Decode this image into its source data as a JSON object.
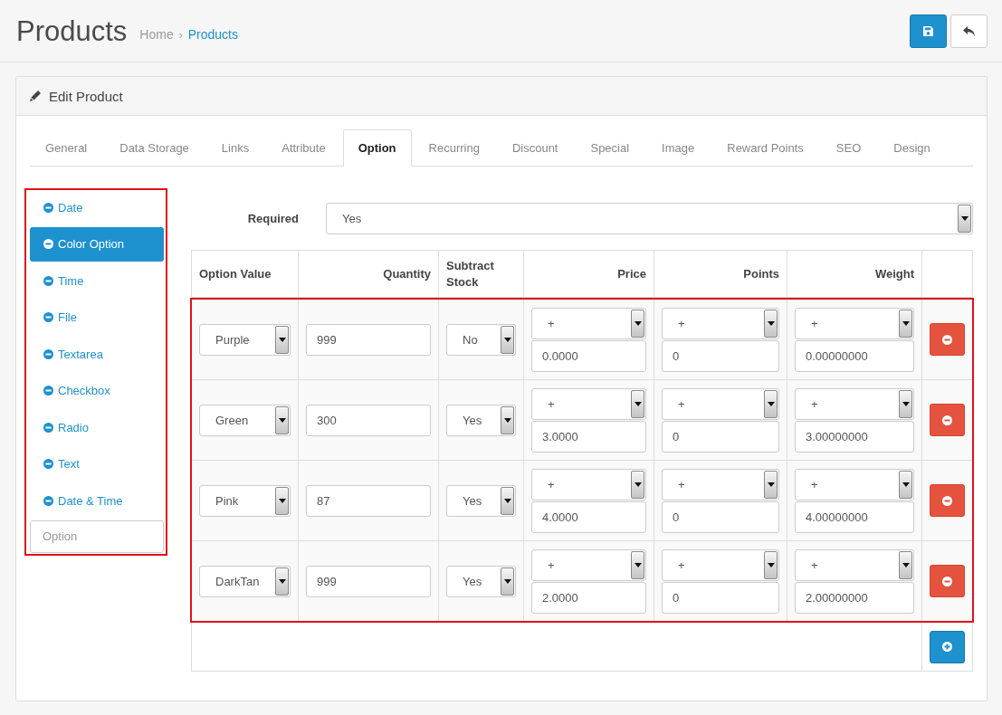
{
  "header": {
    "title": "Products",
    "separator": "›",
    "breadcrumb": [
      {
        "label": "Home",
        "current": false
      },
      {
        "label": "Products",
        "current": true
      }
    ],
    "toolbar": [
      {
        "kind": "save"
      },
      {
        "kind": "back"
      }
    ]
  },
  "panel": {
    "title": "Edit Product"
  },
  "tabs": [
    {
      "label": "General",
      "selected": false
    },
    {
      "label": "Data Storage",
      "selected": false
    },
    {
      "label": "Links",
      "selected": false
    },
    {
      "label": "Attribute",
      "selected": false
    },
    {
      "label": "Option",
      "selected": true
    },
    {
      "label": "Recurring",
      "selected": false
    },
    {
      "label": "Discount",
      "selected": false
    },
    {
      "label": "Special",
      "selected": false
    },
    {
      "label": "Image",
      "selected": false
    },
    {
      "label": "Reward Points",
      "selected": false
    },
    {
      "label": "SEO",
      "selected": false
    },
    {
      "label": "Design",
      "selected": false
    }
  ],
  "option_list": {
    "highlighted": true,
    "items": [
      {
        "label": "Date",
        "selected": false
      },
      {
        "label": "Color Option",
        "selected": true
      },
      {
        "label": "Time",
        "selected": false
      },
      {
        "label": "File",
        "selected": false
      },
      {
        "label": "Textarea",
        "selected": false
      },
      {
        "label": "Checkbox",
        "selected": false
      },
      {
        "label": "Radio",
        "selected": false
      },
      {
        "label": "Text",
        "selected": false
      },
      {
        "label": "Date & Time",
        "selected": false
      }
    ],
    "search": {
      "placeholder": "Option"
    }
  },
  "required": {
    "label": "Required",
    "value": "Yes"
  },
  "option_values": {
    "highlighted": true,
    "columns": [
      "Option Value",
      "Quantity",
      "Subtract Stock",
      "Price",
      "Points",
      "Weight"
    ],
    "rows": [
      {
        "option_value": "Purple",
        "quantity": "999",
        "subtract": "No",
        "price_prefix": "+",
        "price": "0.0000",
        "points_prefix": "+",
        "points": "0",
        "weight_prefix": "+",
        "weight": "0.00000000"
      },
      {
        "option_value": "Green",
        "quantity": "300",
        "subtract": "Yes",
        "price_prefix": "+",
        "price": "3.0000",
        "points_prefix": "+",
        "points": "0",
        "weight_prefix": "+",
        "weight": "3.00000000"
      },
      {
        "option_value": "Pink",
        "quantity": "87",
        "subtract": "Yes",
        "price_prefix": "+",
        "price": "4.0000",
        "points_prefix": "+",
        "points": "0",
        "weight_prefix": "+",
        "weight": "4.00000000"
      },
      {
        "option_value": "DarkTan",
        "quantity": "999",
        "subtract": "Yes",
        "price_prefix": "+",
        "price": "2.0000",
        "points_prefix": "+",
        "points": "0",
        "weight_prefix": "+",
        "weight": "2.00000000"
      }
    ]
  }
}
